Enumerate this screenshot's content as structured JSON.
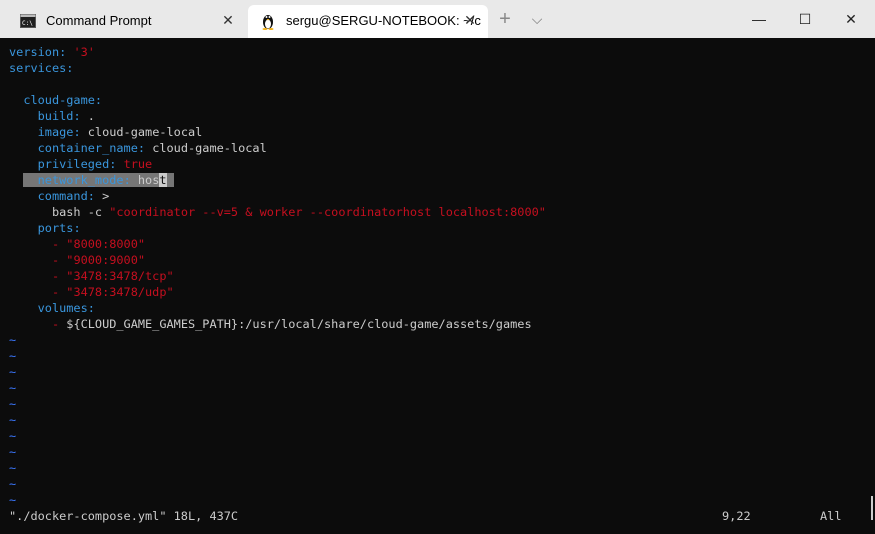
{
  "tabs": [
    {
      "label": "Command Prompt",
      "icon": "cmd-icon"
    },
    {
      "label": "sergu@SERGU-NOTEBOOK: ~/c",
      "icon": "linux-penguin-icon"
    }
  ],
  "window_controls": {
    "new_tab": "+",
    "dropdown": "⌵",
    "minimize": "—",
    "maximize": "☐",
    "close": "✕"
  },
  "editor": {
    "l1_key": "version",
    "l1_sep": ": ",
    "l1_val": "'3'",
    "l2_key": "services",
    "l2_sep": ":",
    "l3_key": "  cloud-game",
    "l3_sep": ":",
    "l4_key": "    build",
    "l4_sep": ": ",
    "l4_val": ".",
    "l5_key": "    image",
    "l5_sep": ": ",
    "l5_val": "cloud-game-local",
    "l6_key": "    container_name",
    "l6_sep": ": ",
    "l6_val": "cloud-game-local",
    "l7_key": "    privileged",
    "l7_sep": ": ",
    "l7_val": "true",
    "l8_indent": "  ",
    "l8_key": "  network_mode",
    "l8_sep": ": ",
    "l8_val_a": "hos",
    "l8_val_cursor": "t",
    "l8_val_b": " ",
    "l9_key": "    command",
    "l9_sep": ": ",
    "l9_val": ">",
    "l10_cmd": "      bash -c ",
    "l10_val": "\"coordinator --v=5 & worker --coordinatorhost localhost:8000\"",
    "l11_key": "    ports",
    "l11_sep": ":",
    "l12_dash": "      - ",
    "l12_val": "\"8000:8000\"",
    "l13_dash": "      - ",
    "l13_val": "\"9000:9000\"",
    "l14_dash": "      - ",
    "l14_val": "\"3478:3478/tcp\"",
    "l15_dash": "      - ",
    "l15_val": "\"3478:3478/udp\"",
    "l16_key": "    volumes",
    "l16_sep": ":",
    "l17_dash": "      - ",
    "l17_val": "${CLOUD_GAME_GAMES_PATH}:/usr/local/share/cloud-game/assets/games",
    "tilde": "~"
  },
  "status": {
    "file_info": "\"./docker-compose.yml\" 18L, 437C",
    "position": "9,22",
    "scroll": "All"
  },
  "colors": {
    "keyword": "#3a96dd",
    "string": "#c50f1f",
    "text": "#cccccc",
    "tilde": "#3b78ff",
    "background": "#0c0c0c",
    "highlight": "#767676"
  }
}
